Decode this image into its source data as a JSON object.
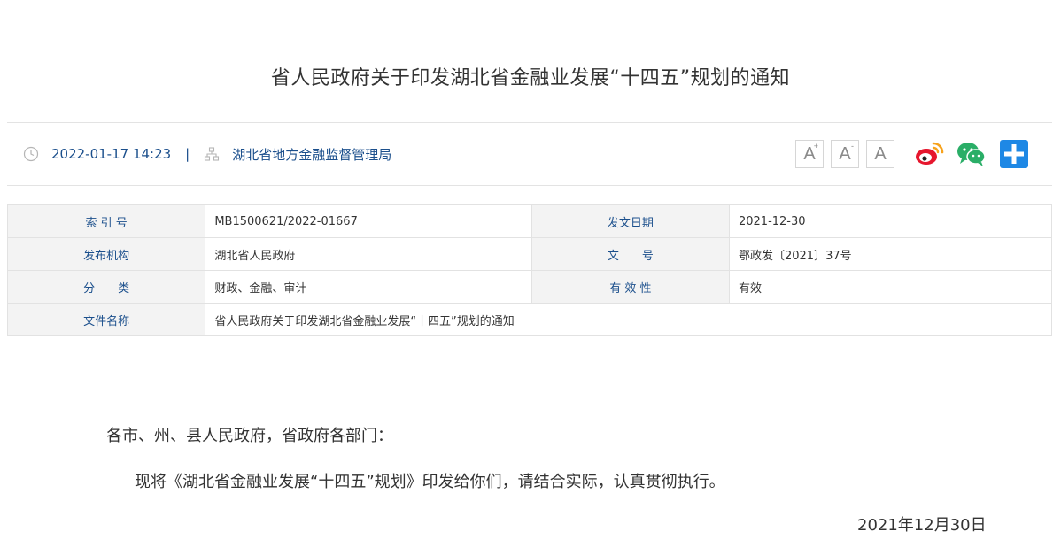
{
  "page": {
    "title": "省人民政府关于印发湖北省金融业发展“十四五”规划的通知"
  },
  "meta": {
    "datetime": "2022-01-17 14:23",
    "separator": "|",
    "source": "湖北省地方金融监督管理局"
  },
  "tools": {
    "font_large": "A",
    "font_large_sup": "+",
    "font_small": "A",
    "font_small_sup": "-",
    "font_reset": "A",
    "share_icons": [
      "weibo-icon",
      "wechat-icon",
      "add-share-icon"
    ],
    "colors": {
      "weibo": "#e6162d",
      "weibo_accent": "#f7a21b",
      "wechat": "#2aae67",
      "plus": "#1e88e5"
    }
  },
  "info_table": {
    "rows": [
      {
        "label1": "索 引 号",
        "value1": "MB1500621/2022-01667",
        "label2": "发文日期",
        "value2": "2021-12-30"
      },
      {
        "label1": "发布机构",
        "value1": "湖北省人民政府",
        "label2": "文　　号",
        "value2": "鄂政发〔2021〕37号"
      },
      {
        "label1": "分　　类",
        "value1": "财政、金融、审计",
        "label2": "有 效 性",
        "value2": "有效"
      }
    ],
    "name_label": "文件名称",
    "name_value": "省人民政府关于印发湖北省金融业发展“十四五”规划的通知"
  },
  "content": {
    "salutation": "各市、州、县人民政府，省政府各部门：",
    "paragraph": "现将《湖北省金融业发展“十四五”规划》印发给你们，请结合实际，认真贯彻执行。",
    "date": "2021年12月30日"
  },
  "colors": {
    "link_blue": "#1b4f8c",
    "label_bg": "#f3f3f3",
    "border": "#e2e2e2"
  }
}
